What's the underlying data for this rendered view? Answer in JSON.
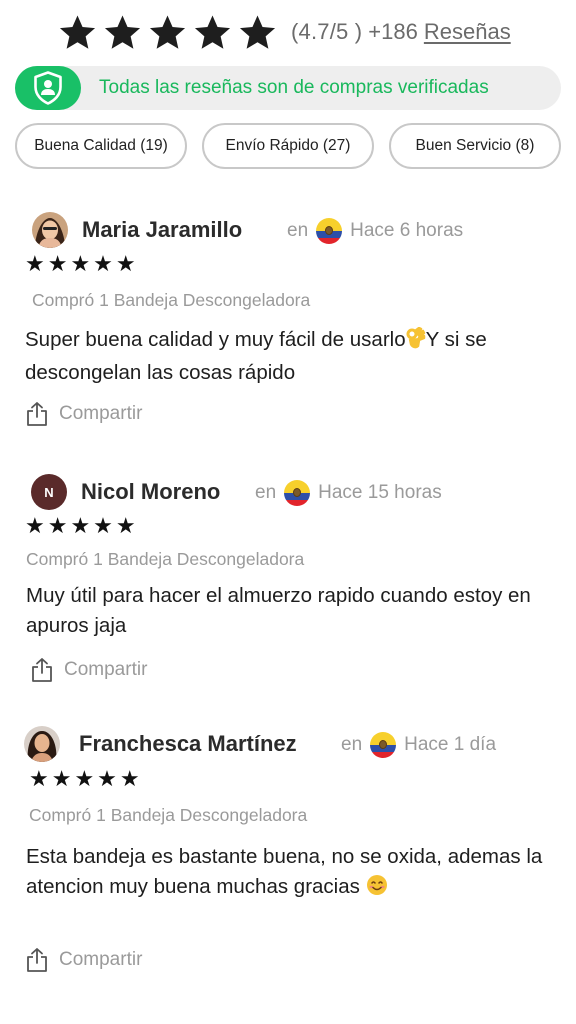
{
  "header": {
    "stars_count": 5,
    "rating_text": "(4.7/5 )",
    "count_text": "+186",
    "reviews_link": "Reseñas",
    "star_color": "#1e1e1e"
  },
  "verified": {
    "text": "Todas las reseñas son de compras verificadas",
    "icon": "shield-user-icon",
    "accent": "#19c067"
  },
  "filters": [
    {
      "label": "Buena Calidad (19)"
    },
    {
      "label": "Envío Rápido (27)"
    },
    {
      "label": "Buen Servicio (8)"
    }
  ],
  "reviews": [
    {
      "name": "Maria Jaramillo",
      "location_prefix": "en",
      "country_flag": "ecuador-flag-icon",
      "time": "Hace 6 horas",
      "stars": "★★★★★",
      "rating": 5,
      "purchase": "Compró 1 Bandeja Descongeladora",
      "text_before": "Super buena calidad y muy fácil de usarlo",
      "emoji": "👌",
      "text_after": "Y si se descongelan las cosas rápido",
      "share_label": "Compartir",
      "avatar": "photo"
    },
    {
      "name": "Nicol Moreno",
      "location_prefix": "en",
      "country_flag": "ecuador-flag-icon",
      "time": "Hace 15 horas",
      "stars": "★★★★★",
      "rating": 5,
      "purchase": "Compró 1 Bandeja Descongeladora",
      "text": "Muy útil para hacer el almuerzo rapido cuando estoy en apuros jaja",
      "share_label": "Compartir",
      "avatar_initial": "N",
      "avatar_color": "#5a2a2a"
    },
    {
      "name": "Franchesca Martínez",
      "location_prefix": "en",
      "country_flag": "ecuador-flag-icon",
      "time": "Hace 1 día",
      "stars": "★★★★★",
      "rating": 5,
      "purchase": "Compró 1 Bandeja Descongeladora",
      "text": "Esta bandeja es bastante buena, no se oxida, ademas la atencion muy buena muchas gracias",
      "emoji": "😊",
      "share_label": "Compartir",
      "avatar": "photo"
    }
  ]
}
